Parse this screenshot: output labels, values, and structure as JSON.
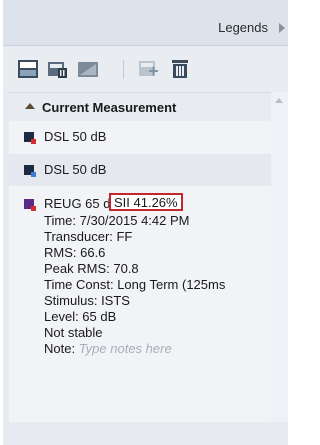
{
  "header": {
    "title": "Legends"
  },
  "toolbar": {
    "icons": [
      "legend-layout-icon",
      "legend-delete-icon",
      "legend-layout-alt-icon",
      "add-note-icon",
      "trash-icon"
    ]
  },
  "section": {
    "title": "Current Measurement"
  },
  "items": [
    {
      "name": "DSL 50 dB",
      "color": "#1e2a44",
      "dot": "#d32f2f"
    },
    {
      "name": "DSL 50 dB",
      "color": "#1e2a44",
      "dot": "#3a7bd5"
    }
  ],
  "detail": {
    "name": "REUG 65 dB",
    "color": "#5b2a86",
    "dot": "#d32f2f",
    "sii": "SII 41.26%",
    "lines": [
      "Time:  7/30/2015 4:42 PM",
      "Transducer:  FF",
      "RMS:  66.6",
      "Peak RMS:  70.8",
      "Time Const:  Long Term (125ms",
      "Stimulus:  ISTS",
      "Level:  65 dB",
      "Not stable"
    ],
    "note_label": "Note:",
    "note_placeholder": "Type notes here"
  }
}
